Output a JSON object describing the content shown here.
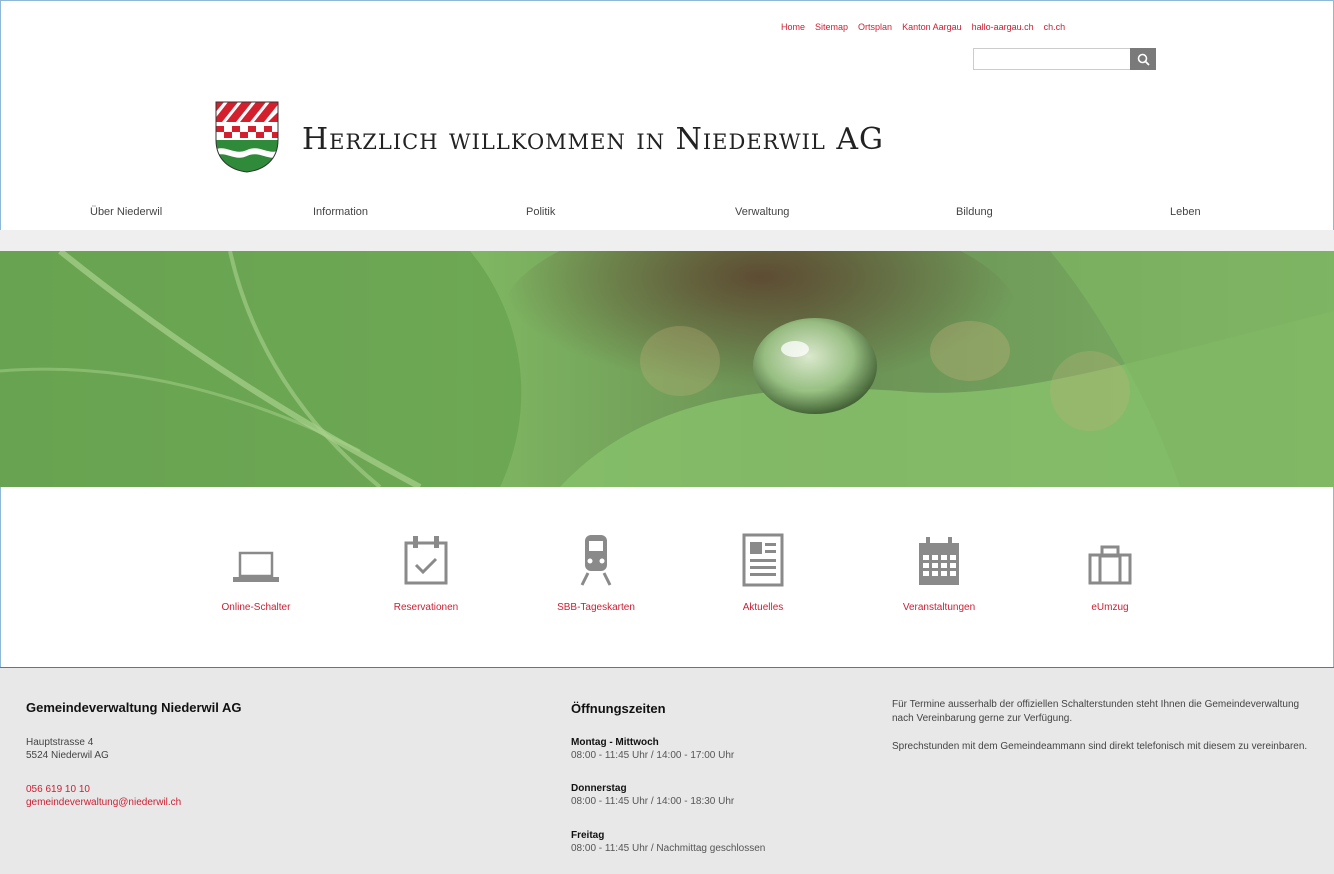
{
  "toplinks": [
    "Home",
    "Sitemap",
    "Ortsplan",
    "Kanton Aargau",
    "hallo-aargau.ch",
    "ch.ch"
  ],
  "search": {
    "placeholder": ""
  },
  "header": {
    "title": "Herzlich willkommen in Niederwil AG"
  },
  "nav": [
    "Über Niederwil",
    "Information",
    "Politik",
    "Verwaltung",
    "Bildung",
    "Leben"
  ],
  "quicklinks": [
    {
      "label": "Online-Schalter",
      "icon": "laptop-icon"
    },
    {
      "label": "Reservationen",
      "icon": "calendar-check-icon"
    },
    {
      "label": "SBB-Tageskarten",
      "icon": "train-icon"
    },
    {
      "label": "Aktuelles",
      "icon": "newspaper-icon"
    },
    {
      "label": "Veranstaltungen",
      "icon": "calendar-grid-icon"
    },
    {
      "label": "eUmzug",
      "icon": "briefcase-icon"
    }
  ],
  "footer": {
    "org": "Gemeindeverwaltung Niederwil AG",
    "address": [
      "Hauptstrasse 4",
      "5524 Niederwil AG"
    ],
    "phone": "056 619 10 10",
    "email": "gemeindeverwaltung@niederwil.ch",
    "hours_title": "Öffnungszeiten",
    "hours": [
      {
        "day": "Montag - Mittwoch",
        "time": "08:00 - 11:45 Uhr / 14:00 - 17:00 Uhr"
      },
      {
        "day": "Donnerstag",
        "time": "08:00 - 11:45 Uhr / 14:00 - 18:30 Uhr"
      },
      {
        "day": "Freitag",
        "time": "08:00 - 11:45 Uhr / Nachmittag geschlossen"
      }
    ],
    "notes": [
      "Für Termine ausserhalb der offiziellen Schalterstunden steht Ihnen die Gemeindeverwaltung nach Vereinbarung gerne zur Verfügung.",
      "Sprechstunden mit dem Gemeindeammann sind direkt telefonisch mit diesem zu vereinbaren."
    ]
  },
  "colors": {
    "accent": "#cc1f33",
    "footer_bg": "#e8e8e8",
    "icon_gray": "#8a8a8a"
  }
}
